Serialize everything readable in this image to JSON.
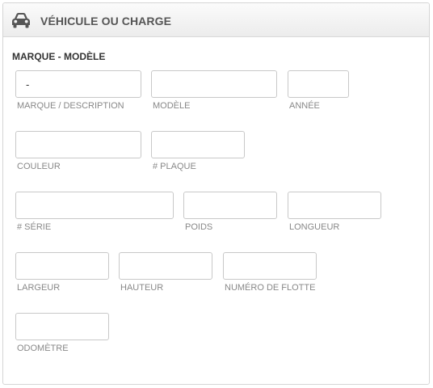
{
  "header": {
    "title": "VÉHICULE OU CHARGE",
    "icon": "car-icon"
  },
  "section": {
    "title": "MARQUE - MODÈLE"
  },
  "fields": {
    "make": {
      "value": "-",
      "label": "MARQUE / DESCRIPTION"
    },
    "model": {
      "value": "",
      "label": "MODÈLE"
    },
    "year": {
      "value": "",
      "label": "ANNÉE"
    },
    "color": {
      "value": "",
      "label": "COULEUR"
    },
    "plate": {
      "value": "",
      "label": "# PLAQUE"
    },
    "serial": {
      "value": "",
      "label": "# SÉRIE"
    },
    "weight": {
      "value": "",
      "label": "POIDS"
    },
    "length": {
      "value": "",
      "label": "LONGUEUR"
    },
    "width": {
      "value": "",
      "label": "LARGEUR"
    },
    "height": {
      "value": "",
      "label": "HAUTEUR"
    },
    "fleet": {
      "value": "",
      "label": "NUMÉRO DE FLOTTE"
    },
    "odometer": {
      "value": "",
      "label": "ODOMÈTRE"
    }
  }
}
